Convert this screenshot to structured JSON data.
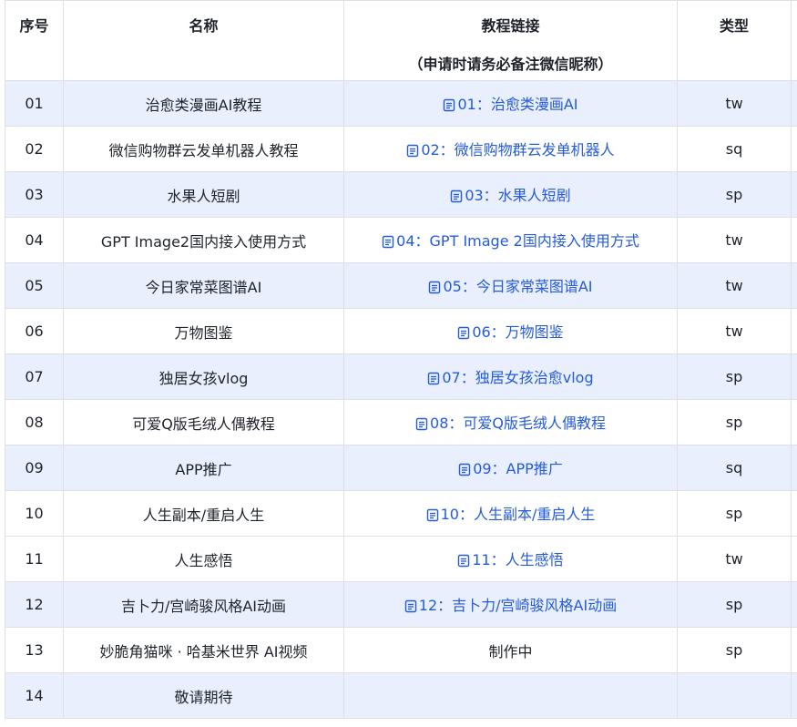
{
  "columns": {
    "index": "序号",
    "name": "名称",
    "link_title": "教程链接",
    "link_subtitle": "（申请时请务必备注微信昵称）",
    "type": "类型"
  },
  "rows": [
    {
      "index": "01",
      "name": "治愈类漫画AI教程",
      "link": "01：治愈类漫画AI",
      "is_link": true,
      "type": "tw",
      "highlight": true
    },
    {
      "index": "02",
      "name": "微信购物群云发单机器人教程",
      "link": "02：微信购物群云发单机器人",
      "is_link": true,
      "type": "sq",
      "highlight": false
    },
    {
      "index": "03",
      "name": "水果人短剧",
      "link": "03：水果人短剧",
      "is_link": true,
      "type": "sp",
      "highlight": true
    },
    {
      "index": "04",
      "name": "GPT Image2国内接入使用方式",
      "link": "04：GPT Image 2国内接入使用方式",
      "is_link": true,
      "type": "tw",
      "highlight": false
    },
    {
      "index": "05",
      "name": "今日家常菜图谱AI",
      "link": "05：今日家常菜图谱AI",
      "is_link": true,
      "type": "tw",
      "highlight": true
    },
    {
      "index": "06",
      "name": "万物图鉴",
      "link": "06：万物图鉴",
      "is_link": true,
      "type": "tw",
      "highlight": false
    },
    {
      "index": "07",
      "name": "独居女孩vlog",
      "link": "07：独居女孩治愈vlog",
      "is_link": true,
      "type": "sp",
      "highlight": true
    },
    {
      "index": "08",
      "name": "可爱Q版毛绒人偶教程",
      "link": "08：可爱Q版毛绒人偶教程",
      "is_link": true,
      "type": "sp",
      "highlight": false
    },
    {
      "index": "09",
      "name": "APP推广",
      "link": "09：APP推广",
      "is_link": true,
      "type": "sq",
      "highlight": true
    },
    {
      "index": "10",
      "name": "人生副本/重启人生",
      "link": "10：人生副本/重启人生",
      "is_link": true,
      "type": "sp",
      "highlight": false
    },
    {
      "index": "11",
      "name": "人生感悟",
      "link": "11：人生感悟",
      "is_link": true,
      "type": "tw",
      "highlight": false
    },
    {
      "index": "12",
      "name": "吉卜力/宫崎骏风格AI动画",
      "link": "12：吉卜力/宫崎骏风格AI动画",
      "is_link": true,
      "type": "sp",
      "highlight": true
    },
    {
      "index": "13",
      "name": "妙脆角猫咪 · 哈基米世界 AI视频",
      "link": "制作中",
      "is_link": false,
      "type": "sp",
      "highlight": false
    },
    {
      "index": "14",
      "name": "敬请期待",
      "link": "",
      "is_link": false,
      "type": "",
      "highlight": true
    }
  ],
  "colors": {
    "link": "#245bdb",
    "row_highlight": "#e9effd",
    "border": "#dee0e3",
    "text": "#1f2329"
  },
  "icons": {
    "link_icon": "doc-icon"
  }
}
